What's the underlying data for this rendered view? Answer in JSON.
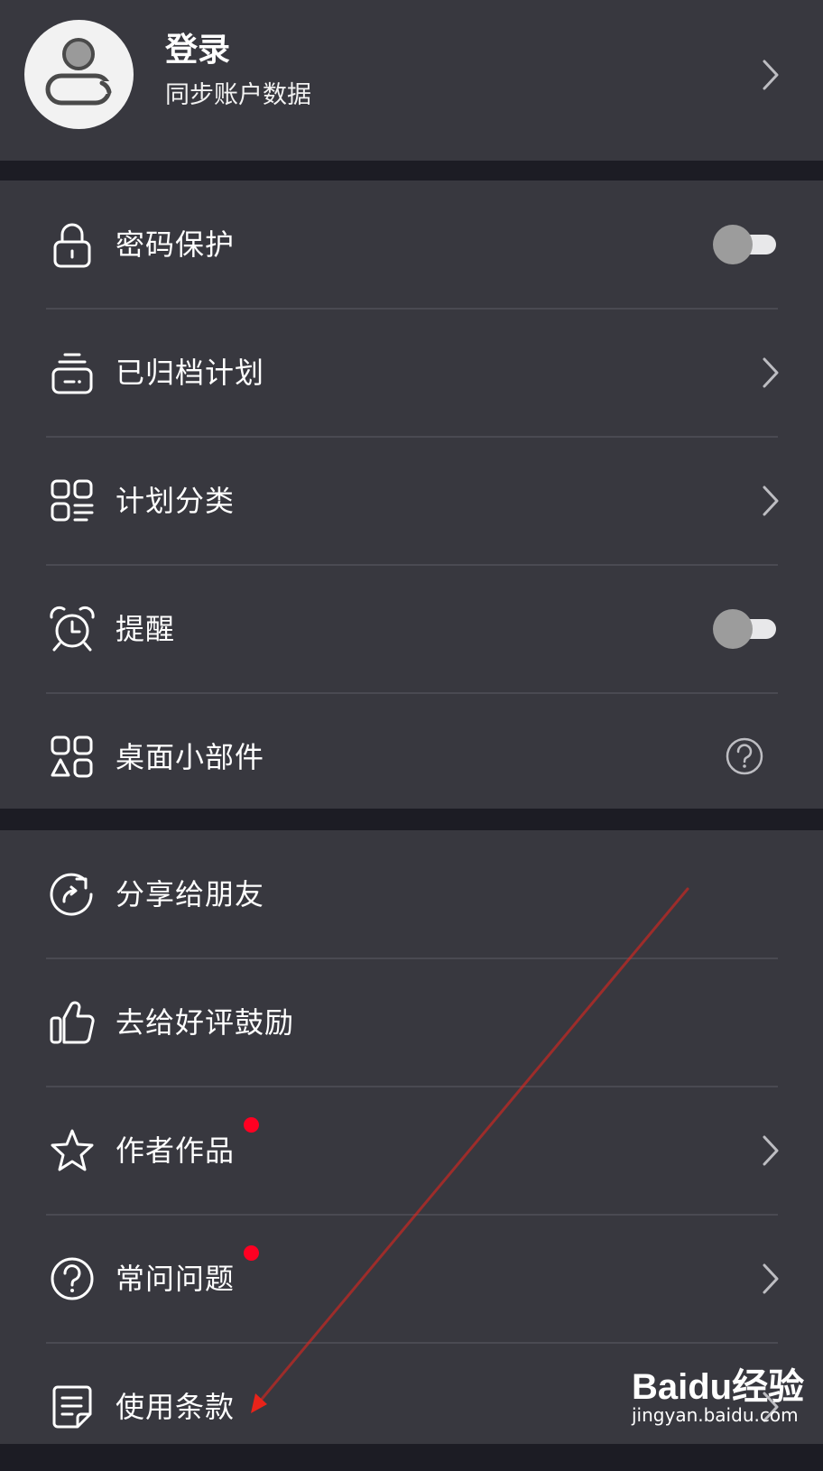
{
  "header": {
    "title": "登录",
    "subtitle": "同步账户数据",
    "avatar_icon": "user-icon",
    "chevron_icon": "chevron-right-icon"
  },
  "settings": {
    "items": [
      {
        "label": "密码保护",
        "icon": "lock-icon",
        "control": "toggle",
        "state": "off"
      },
      {
        "label": "已归档计划",
        "icon": "archive-box-icon",
        "control": "chevron"
      },
      {
        "label": "计划分类",
        "icon": "category-grid-icon",
        "control": "chevron"
      },
      {
        "label": "提醒",
        "icon": "alarm-clock-icon",
        "control": "toggle",
        "state": "off"
      },
      {
        "label": "桌面小部件",
        "icon": "widget-icon",
        "control": "help"
      }
    ]
  },
  "more": {
    "items": [
      {
        "label": "分享给朋友",
        "icon": "share-refresh-icon"
      },
      {
        "label": "去给好评鼓励",
        "icon": "thumbs-up-icon"
      },
      {
        "label": "作者作品",
        "icon": "star-icon",
        "control": "chevron",
        "badge": "red-dot"
      },
      {
        "label": "常问问题",
        "icon": "question-circle-icon",
        "control": "chevron",
        "badge": "red-dot"
      },
      {
        "label": "使用条款",
        "icon": "document-icon",
        "control": "chevron"
      }
    ]
  },
  "watermark": {
    "brand": "Baidu经验",
    "url": "jingyan.baidu.com"
  },
  "colors": {
    "background": "#1c1c24",
    "card": "#38383f",
    "badge": "#ff0022",
    "annotation_arrow": "#e8231a"
  }
}
